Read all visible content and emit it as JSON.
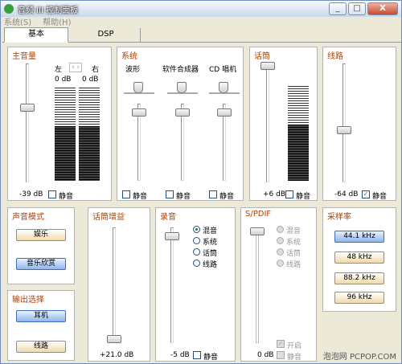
{
  "window": {
    "title": "音频 III 控制面板",
    "min": "_",
    "max": "□",
    "close": "X"
  },
  "menu": [
    "系统(S)",
    "帮助(H)"
  ],
  "tabs": [
    "基本",
    "DSP"
  ],
  "master": {
    "title": "主音量",
    "left": "左",
    "right": "右",
    "left_db": "0 dB",
    "right_db": "0 dB",
    "value": "-39 dB",
    "mute": "静音"
  },
  "system": {
    "title": "系统",
    "channels": [
      "波形",
      "软件合成器",
      "CD 唱机"
    ],
    "mute": "静音"
  },
  "mic": {
    "title": "话筒",
    "value": "+6 dB",
    "mute": "静音"
  },
  "line": {
    "title": "线路",
    "value": "-64 dB",
    "mute": "静音",
    "mute_checked": "✓"
  },
  "sound_mode": {
    "title": "声音模式",
    "buttons": [
      "娱乐",
      "音乐欣赏"
    ]
  },
  "output": {
    "title": "输出选择",
    "buttons": [
      "耳机",
      "线路"
    ]
  },
  "mic_gain": {
    "title": "话筒增益",
    "value": "+21.0 dB"
  },
  "record": {
    "title": "录音",
    "options": [
      "混音",
      "系统",
      "话筒",
      "线路"
    ],
    "value": "-5 dB",
    "mute": "静音"
  },
  "spdif": {
    "title": "S/PDIF",
    "options": [
      "混音",
      "系统",
      "话筒",
      "线路"
    ],
    "value": "0 dB",
    "on": "开启",
    "mute": "静音",
    "check": "✓"
  },
  "sample_rate": {
    "title": "采样率",
    "rates": [
      "44.1 kHz",
      "48 kHz",
      "88.2 kHz",
      "96 kHz"
    ]
  },
  "footer": "泡泡网 PCPOP.COM"
}
